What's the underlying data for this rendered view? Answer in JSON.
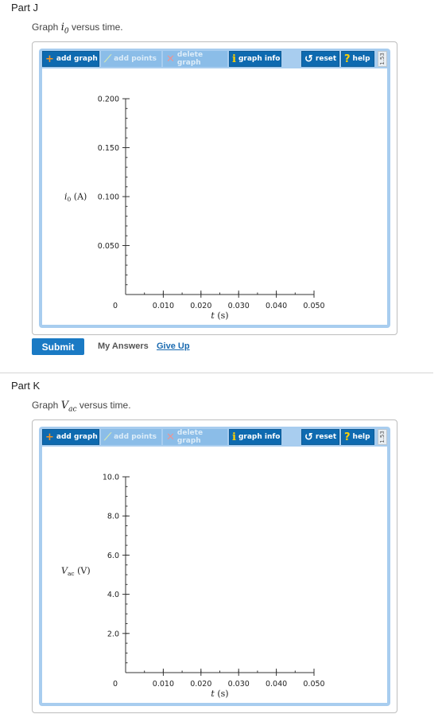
{
  "parts": [
    {
      "title": "Part J",
      "prompt_prefix": "Graph",
      "prompt_var": "i",
      "prompt_sub": "0",
      "prompt_suffix": "versus time.",
      "toolbar": {
        "add_graph": "add graph",
        "add_points": "add points",
        "delete_graph": "delete graph",
        "graph_info": "graph info",
        "reset": "reset",
        "help": "help",
        "version": "1.53"
      },
      "submit": "Submit",
      "my_answers": "My Answers",
      "give_up": "Give Up"
    },
    {
      "title": "Part K",
      "prompt_prefix": "Graph",
      "prompt_var": "V",
      "prompt_sub": "ac",
      "prompt_suffix": "versus time.",
      "toolbar": {
        "add_graph": "add graph",
        "add_points": "add points",
        "delete_graph": "delete graph",
        "graph_info": "graph info",
        "reset": "reset",
        "help": "help",
        "version": "1.53"
      }
    }
  ],
  "chart_data": [
    {
      "type": "line",
      "series": [],
      "xlabel": "t (s)",
      "ylabel": "i0 (A)",
      "ylabel_var": "i",
      "ylabel_sub": "0",
      "ylabel_unit": "(A)",
      "xlabel_var": "t",
      "xlabel_unit": "(s)",
      "x_ticks": [
        "0",
        "0.010",
        "0.020",
        "0.030",
        "0.040",
        "0.050"
      ],
      "x_tick_values": [
        0,
        0.01,
        0.02,
        0.03,
        0.04,
        0.05
      ],
      "y_ticks": [
        "0.050",
        "0.100",
        "0.150",
        "0.200"
      ],
      "y_tick_values": [
        0.05,
        0.1,
        0.15,
        0.2
      ],
      "xlim": [
        0,
        0.05
      ],
      "ylim": [
        0,
        0.2
      ],
      "x_minor_step": 0.005,
      "y_minor_step": 0.01,
      "grid": false
    },
    {
      "type": "line",
      "series": [],
      "xlabel": "t (s)",
      "ylabel": "Vac (V)",
      "ylabel_var": "V",
      "ylabel_sub": "ac",
      "ylabel_unit": "(V)",
      "xlabel_var": "t",
      "xlabel_unit": "(s)",
      "x_ticks": [
        "0",
        "0.010",
        "0.020",
        "0.030",
        "0.040",
        "0.050"
      ],
      "x_tick_values": [
        0,
        0.01,
        0.02,
        0.03,
        0.04,
        0.05
      ],
      "y_ticks": [
        "2.0",
        "4.0",
        "6.0",
        "8.0",
        "10.0"
      ],
      "y_tick_values": [
        2,
        4,
        6,
        8,
        10
      ],
      "xlim": [
        0,
        0.05
      ],
      "ylim": [
        0,
        10
      ],
      "x_minor_step": 0.005,
      "y_minor_step": 0.5,
      "grid": false
    }
  ],
  "colors": {
    "toolbar_blue": "#0e6ab0",
    "toolbar_disabled": "#8bbde8",
    "frame_blue": "#a8cdef",
    "submit_blue": "#1a7ac4",
    "link_blue": "#1a6ab0"
  }
}
